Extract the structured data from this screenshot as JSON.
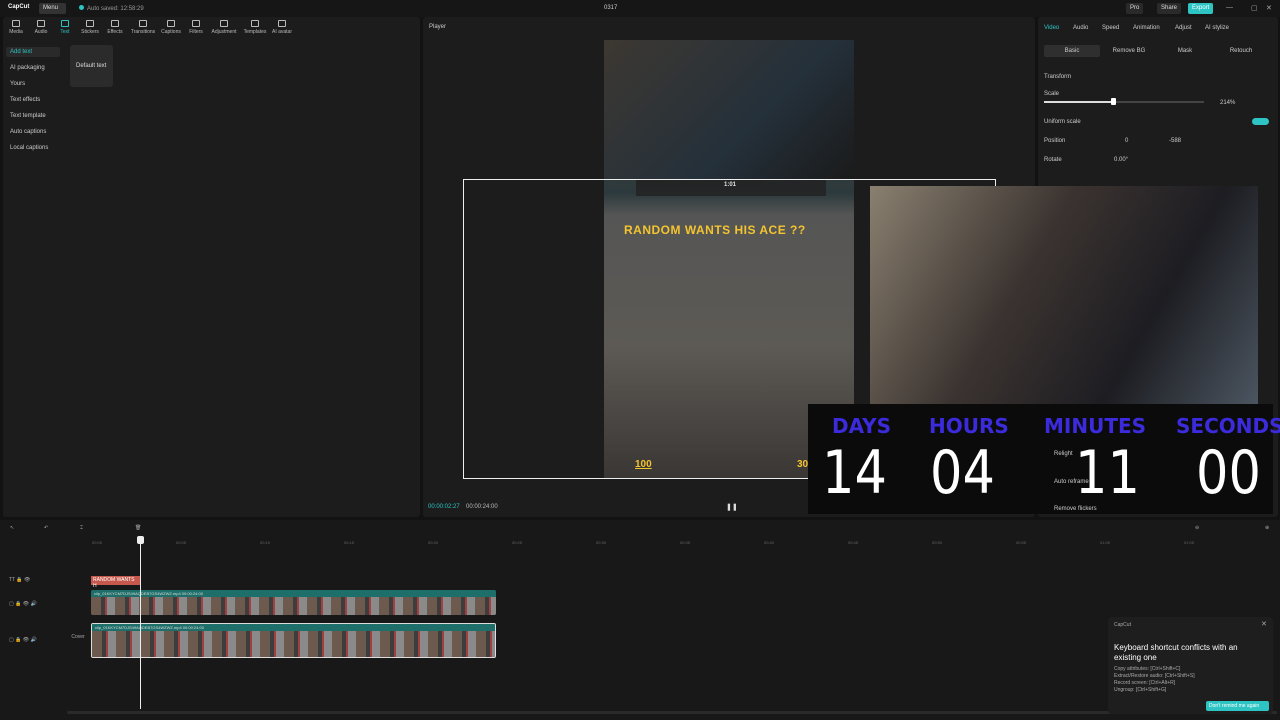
{
  "titlebar": {
    "app": "CapCut",
    "menu": "Menu",
    "autosave": "Auto saved: 12:58:29",
    "project": "0317",
    "pro": "Pro",
    "share": "Share",
    "export": "Export"
  },
  "toolbar": [
    "Media",
    "Audio",
    "Text",
    "Stickers",
    "Effects",
    "Transitions",
    "Captions",
    "Filters",
    "Adjustment",
    "Templates",
    "AI avatar"
  ],
  "sidebar": [
    "Add text",
    "AI packaging",
    "Yours",
    "Text effects",
    "Text template",
    "Auto captions",
    "Local captions"
  ],
  "text_panel": {
    "default": "Default text"
  },
  "player": {
    "label": "Player",
    "caption": "RANDOM WANTS HIS ACE ??",
    "time_current": "00:00:02:27",
    "time_total": "00:00:24:00",
    "hud_time": "1:01",
    "hp": "100",
    "ammo": "30"
  },
  "countdown": {
    "days_l": "DAYS",
    "hours_l": "HOURS",
    "minutes_l": "MINUTES",
    "seconds_l": "SECONDS",
    "days": "14",
    "hours": "04",
    "minutes": "11",
    "seconds": "00"
  },
  "right": {
    "tabs": [
      "Video",
      "Audio",
      "Speed",
      "Animation",
      "Adjust",
      "AI stylize"
    ],
    "subtabs": [
      "Basic",
      "Remove BG",
      "Mask",
      "Retouch"
    ],
    "transform": "Transform",
    "scale": "Scale",
    "scale_val": "214%",
    "uniform": "Uniform scale",
    "position": "Position",
    "pos_x": "0",
    "pos_y": "-588",
    "rotate": "Rotate",
    "rotate_val": "0.00°",
    "relight": "Relight",
    "auto_reframe": "Auto reframe",
    "remove_flickers": "Remove flickers"
  },
  "timeline": {
    "ruler": [
      "00:00",
      "00:05",
      "00:10",
      "00:15",
      "00:20",
      "00:25",
      "00:30",
      "00:35",
      "00:40",
      "00:45",
      "00:50",
      "00:55",
      "01:00",
      "01:05"
    ],
    "text_clip": "RANDOM WANTS H",
    "clip1": "clip_01KKYCM7DJS49AQDEB7GS4WZWZ.mp4   00:00:24:00",
    "clip2": "clip_01KKYCM7DJS49AQDEB7GS4WZWZ.mp4   00:00:24:00",
    "cover": "Cover"
  },
  "toast": {
    "brand": "CapCut",
    "title": "Keyboard shortcut conflicts with an existing one",
    "l1": "Copy attributes: [Ctrl+Shift+C]",
    "l2": "Extract/Restore audio: [Ctrl+Shift+S]",
    "l3": "Record screen: [Ctrl+Alt+R]",
    "l4": "Ungroup: [Ctrl+Shift+G]",
    "button": "Don't remind me again"
  }
}
